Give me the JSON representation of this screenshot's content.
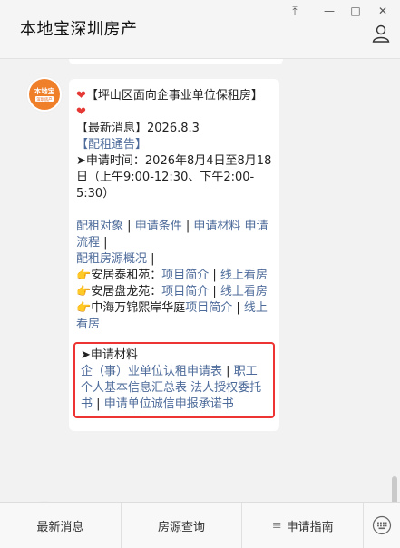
{
  "window": {
    "title": "本地宝深圳房产",
    "controls": {
      "pin": "⤒",
      "minimize": "—",
      "maximize": "□",
      "close": "✕"
    }
  },
  "avatar": {
    "brand": "本地宝",
    "subtitle": "深圳房产"
  },
  "message": {
    "heart": "❤",
    "title_text": "【坪山区面向企事业单位保租房】",
    "news": "【最新消息】2026.8.3",
    "notice_link": "【配租通告】",
    "arrow": "➤",
    "apply_time": "申请时间：2026年8月4日至8月18日（上午9:00-12:30、下午2:00-5:30）",
    "sep": "|",
    "links1": [
      "配租对象",
      "申请条件",
      "申请材料",
      "申请流程"
    ],
    "overview_link": "配租房源概况",
    "hand": "👉",
    "projects": [
      {
        "name": "安居泰和苑：",
        "intro": "项目简介",
        "view": "线上看房"
      },
      {
        "name": "安居盘龙苑：",
        "intro": "项目简介",
        "view": "线上看房"
      },
      {
        "name": "中海万锦熙岸华庭",
        "intro": "项目简介",
        "view": "线上看房"
      }
    ],
    "materials": {
      "heading": "申请材料",
      "link1": "企（事）业单位认租申请表",
      "link2": "职工个人基本信息汇总表",
      "link3": "法人授权委托书",
      "link4": "申请单位诚信申报承诺书"
    }
  },
  "menu": {
    "items": [
      "最新消息",
      "房源查询",
      "申请指南"
    ],
    "menu_glyph": "≡"
  }
}
